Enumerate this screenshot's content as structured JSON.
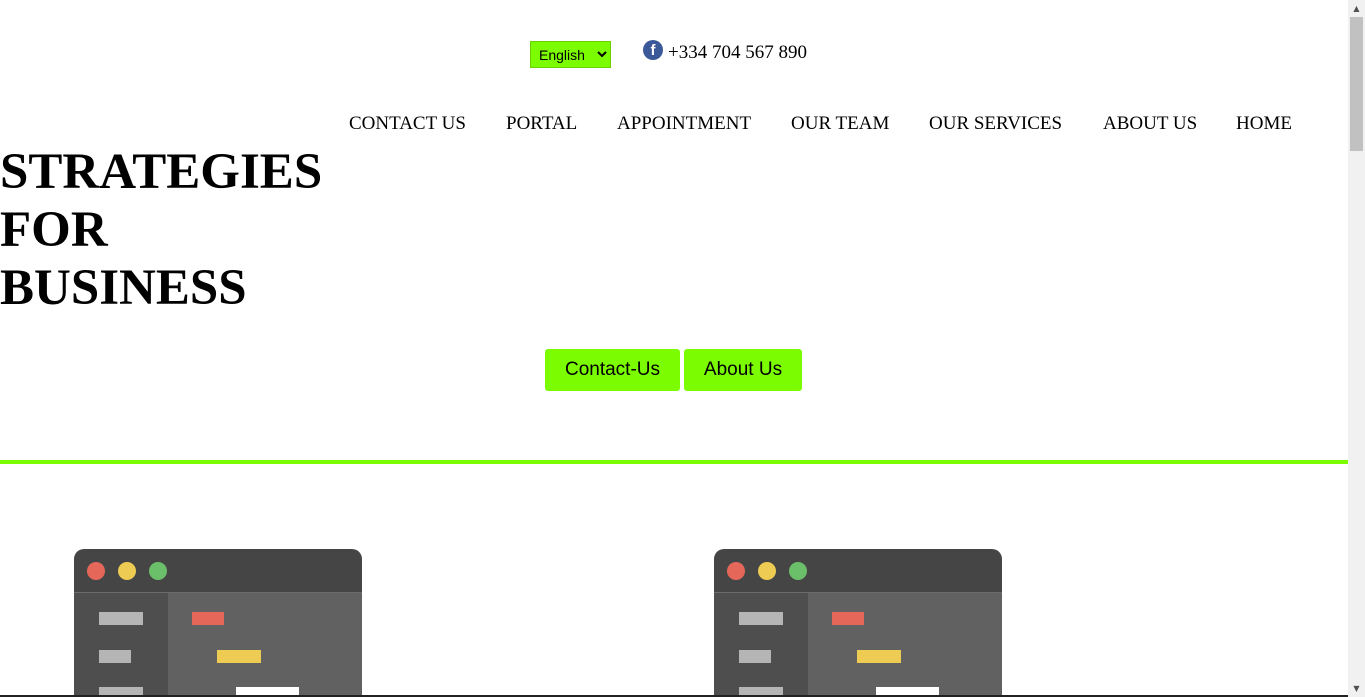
{
  "header": {
    "language_select": {
      "selected": "English",
      "options": [
        "English"
      ],
      "accent_color": "#7cfc00"
    },
    "social_icon": "facebook-icon",
    "facebook_glyph": "f",
    "phone": "+334 704 567 890"
  },
  "nav": {
    "items": [
      {
        "label": "CONTACT US"
      },
      {
        "label": "PORTAL"
      },
      {
        "label": "APPOINTMENT"
      },
      {
        "label": "OUR TEAM"
      },
      {
        "label": "OUR SERVICES"
      },
      {
        "label": "ABOUT US"
      },
      {
        "label": "HOME"
      }
    ]
  },
  "hero": {
    "title_lines": [
      "STRATEGIES",
      "FOR",
      "BUSINESS"
    ],
    "buttons": {
      "contact": "Contact-Us",
      "about": "About Us"
    },
    "button_color": "#7cfc00",
    "divider_color": "#7cfc00"
  },
  "illustrations": {
    "icon": "code-editor-window-icon",
    "count": 2,
    "dot_colors": [
      "#e5675a",
      "#eecb52",
      "#6bbf6a"
    ]
  },
  "scrollbar": {
    "up_arrow": "▲",
    "down_arrow": "▼"
  }
}
